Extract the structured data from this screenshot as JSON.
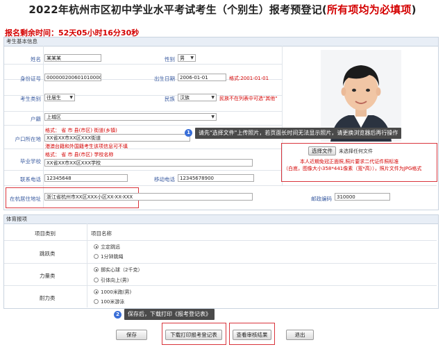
{
  "header": {
    "title_main": "2022年杭州市区初中学业水平考试考生（个别生）报考预登记(",
    "title_emphasis": "所有项均为必填项",
    "title_close": ")"
  },
  "countdown": "报名剩余时间：52天05小时16分30秒",
  "basic": {
    "section_title": "考生基本信息",
    "name_label": "姓名",
    "name_value": "某某某",
    "gender_label": "性别",
    "gender_value": "男",
    "id_label": "身份证号",
    "id_value": "000000200601010000",
    "birth_label": "出生日期",
    "birth_value": "2006-01-01",
    "birth_format": "格式:2001-01-01",
    "type_label": "考生类别",
    "type_value": "往届生",
    "ethnic_label": "民族",
    "ethnic_value": "汉族",
    "ethnic_note": "民族不在列表中可选\"其他\"",
    "huji_label": "户籍",
    "huji_value": "上城区",
    "hukou_label": "户口所在地",
    "hukou_format": "格式：  省    市    县(市区)    街道(乡镇)",
    "hukou_value": "XX省XX市XX区XXX街道",
    "hukou_note": "港澳台籍和外国籍考生该项信息可不填",
    "school_label": "毕业学校",
    "school_format": "格式：  省    市    县(市区)    学校名称",
    "school_value": "XX省XX市XX区XXX学校",
    "phone_label": "联系电话",
    "phone_value": "12345648",
    "mobile_label": "移动电话",
    "mobile_value": "12345678900",
    "address_label": "在杭居住地址",
    "address_value": "浙江省杭州市XX区XXX小区XX-XX-XXX",
    "postcode_label": "邮政编码",
    "postcode_value": "310000",
    "upload_button": "选择文件",
    "upload_status": "未选择任何文件",
    "upload_note1": "本人近期免冠正面照,照片要求二代证件照标准",
    "upload_note2": "（白底，图像大小358*441像素（宽*高）），照片文件为JPG格式"
  },
  "tips": {
    "tip1_num": "1",
    "tip1": "请先\"选择文件\"上传照片，若页面长时间无法显示照片，请更换浏览器后再行操作",
    "tip2_num": "2",
    "tip2": "保存后，下载打印《报考登记表》"
  },
  "sports": {
    "section_title": "体育报项",
    "col_category": "项目类别",
    "col_name": "项目名称",
    "rows": [
      {
        "category": "跳跃类",
        "options": [
          "立定跳远",
          "1分钟跳绳"
        ],
        "selected": 0
      },
      {
        "category": "力量类",
        "options": [
          "掷实心球（2千克）",
          "引体向上(男)"
        ],
        "selected": 0
      },
      {
        "category": "耐力类",
        "options": [
          "1000米跑(男)",
          "100米游泳"
        ],
        "selected": 0
      }
    ]
  },
  "actions": {
    "save": "保存",
    "download": "下载打印报考登记表",
    "check": "查看审核结果",
    "exit": "退出"
  },
  "colors": {
    "accent_red": "#d40000",
    "label_blue": "#3a5ba0",
    "tip_bg": "#4a4a4a",
    "tip_badge": "#3a6fd8"
  }
}
